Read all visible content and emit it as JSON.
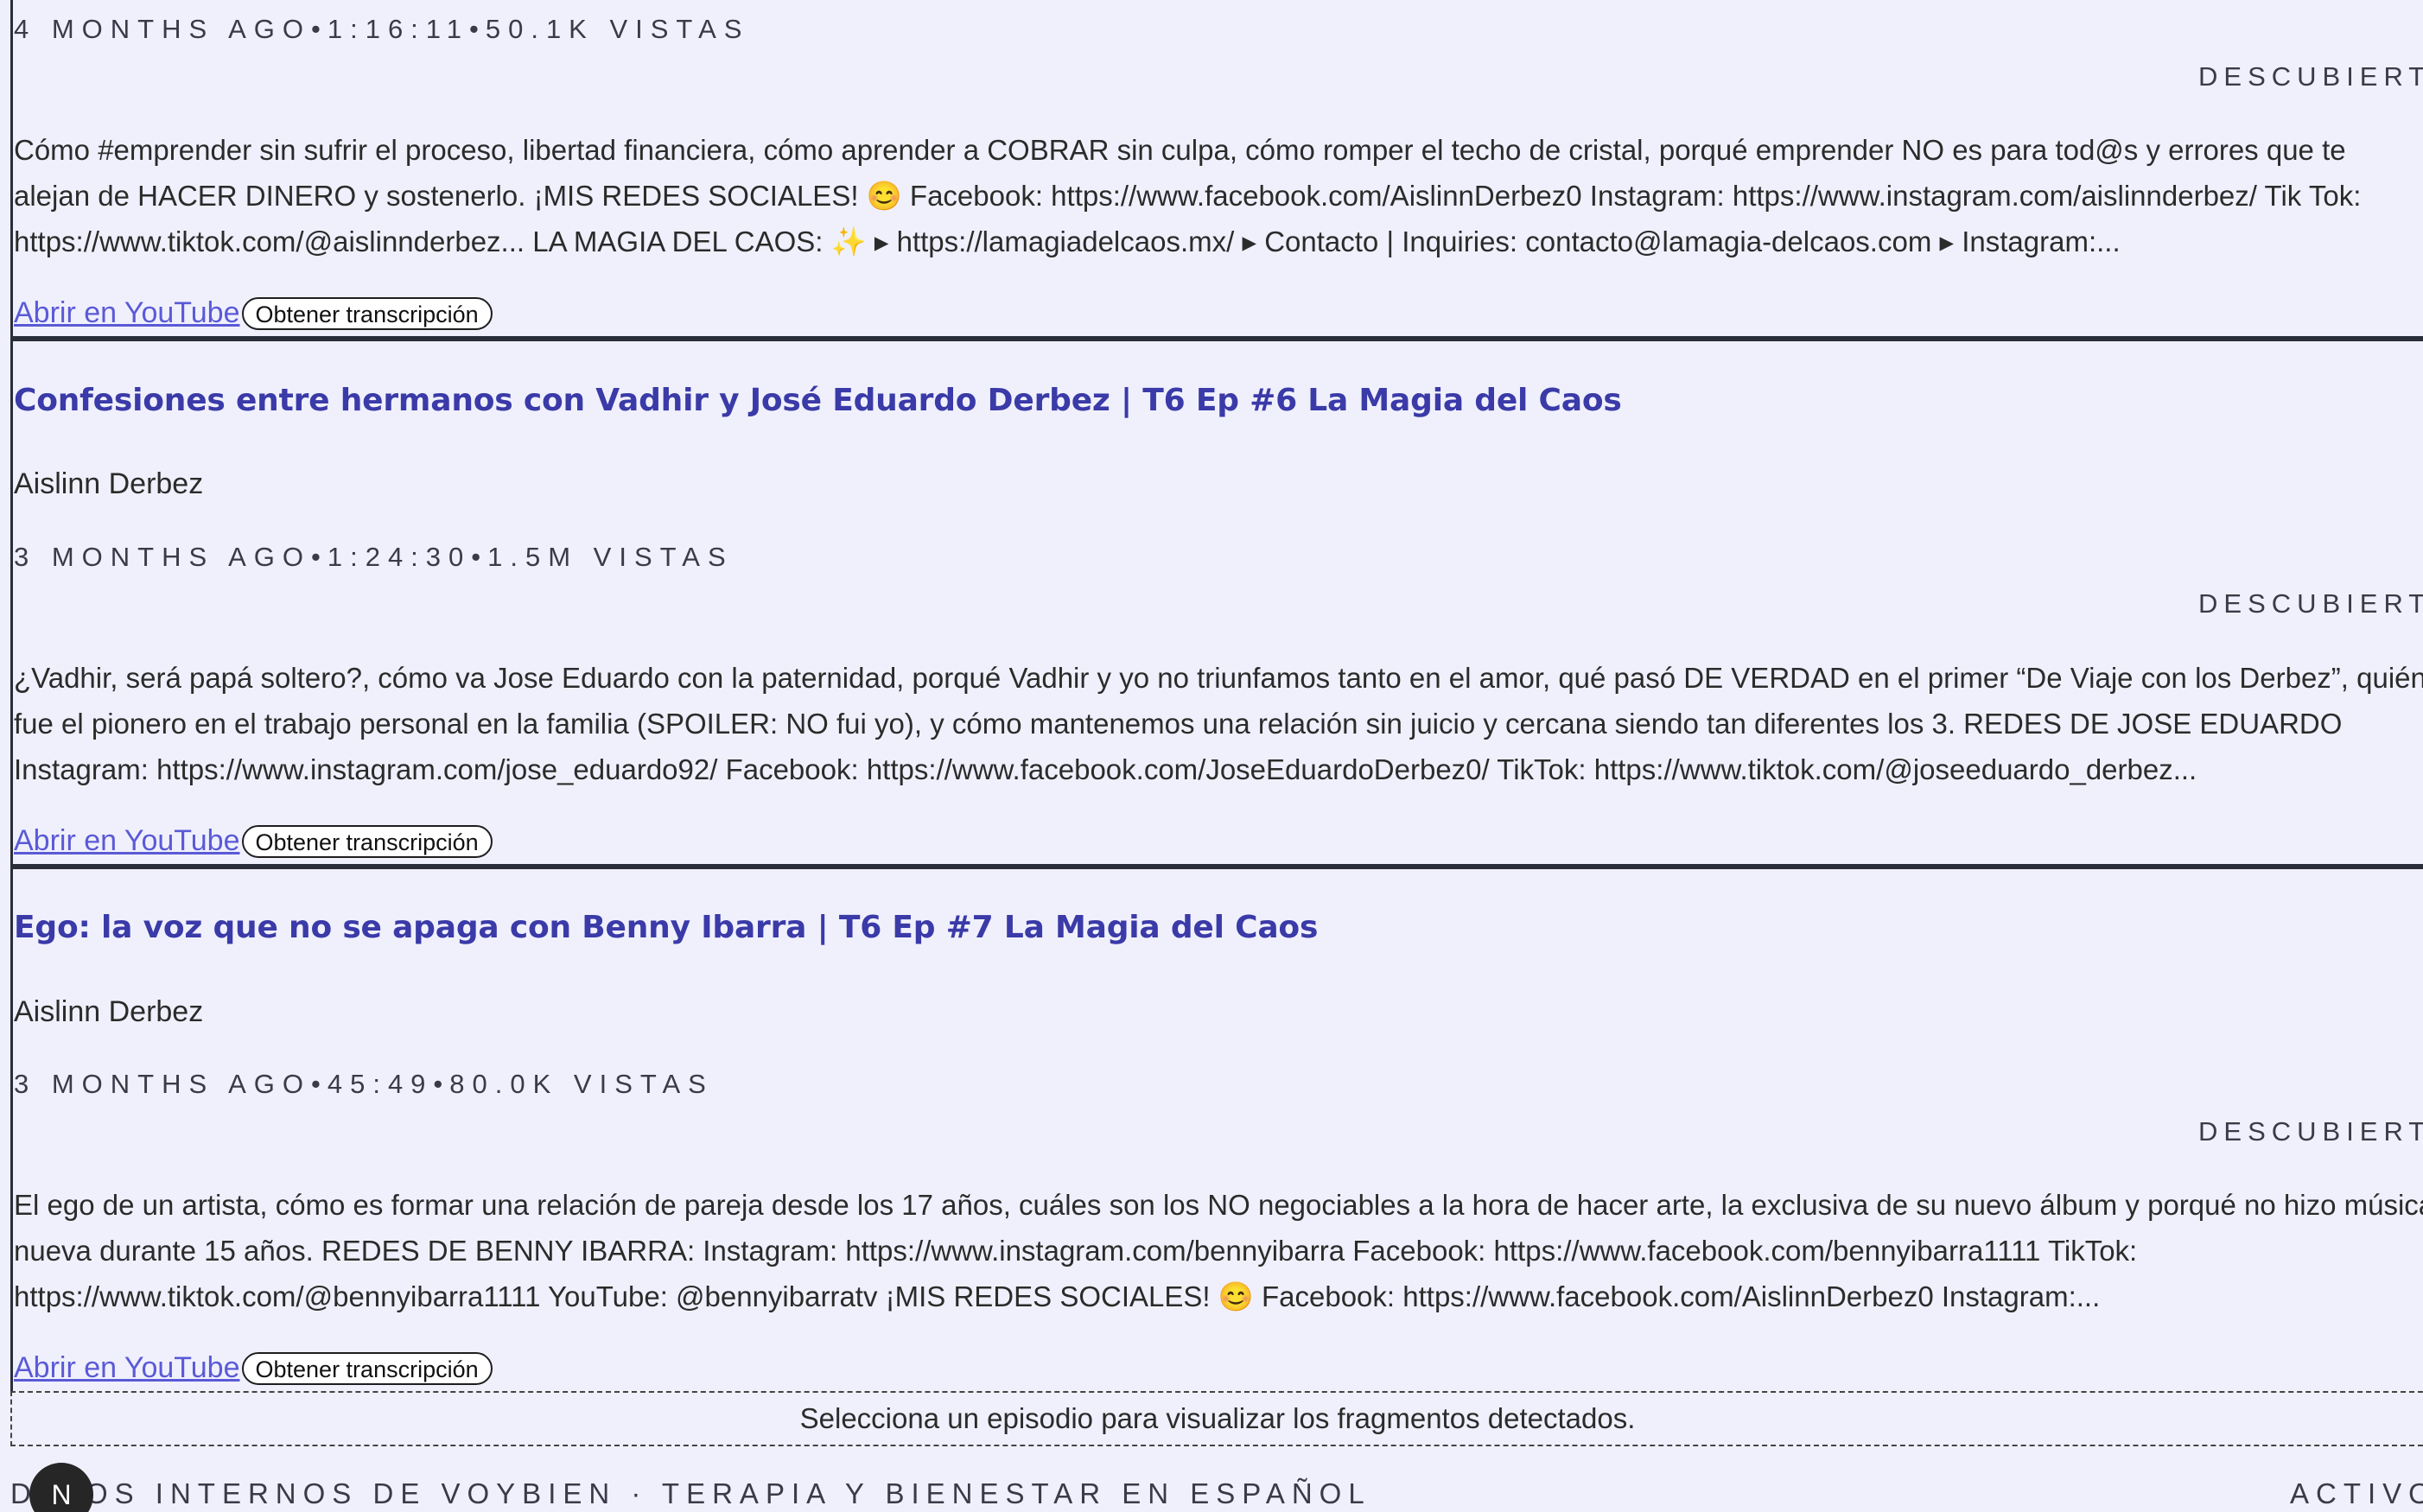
{
  "episodes": [
    {
      "title": "",
      "channel": "",
      "meta": {
        "age": "4 MONTHS AGO",
        "duration": "1:16:11",
        "views": "50.1K VISTAS"
      },
      "status": "DESCUBIERTO",
      "description_lines": [
        "Cómo #emprender sin sufrir el proceso, libertad financiera, cómo aprender a COBRAR sin culpa, cómo romper el techo de cristal, porqué emprender NO es para tod@s y errores que te",
        "alejan de HACER DINERO y sostenerlo. ¡MIS REDES SOCIALES! 😊 Facebook: https://www.facebook.com/AislinnDerbez0 Instagram: https://www.instagram.com/aislinnderbez/ Tik Tok:",
        "https://www.tiktok.com/@aislinnderbez... LA MAGIA DEL CAOS: ✨ ▸ https://lamagiadelcaos.mx/ ▸ Contacto | Inquiries: contacto@lamagia-delcaos.com ▸ Instagram:..."
      ],
      "open_label": "Abrir en YouTube",
      "transcript_label": "Obtener transcripción"
    },
    {
      "title": "Confesiones entre hermanos con Vadhir y José Eduardo Derbez | T6 Ep #6 La Magia del Caos",
      "channel": "Aislinn Derbez",
      "meta": {
        "age": "3 MONTHS AGO",
        "duration": "1:24:30",
        "views": "1.5M VISTAS"
      },
      "status": "DESCUBIERTO",
      "description_lines": [
        "¿Vadhir, será papá soltero?, cómo va Jose Eduardo con la paternidad, porqué Vadhir y yo no triunfamos tanto en el amor, qué pasó DE VERDAD en el primer “De Viaje con los Derbez”, quién",
        "fue el pionero en el trabajo personal en la familia (SPOILER: NO fui yo), y cómo mantenemos una relación sin juicio y cercana siendo tan diferentes los 3. REDES DE JOSE EDUARDO",
        "Instagram: https://www.instagram.com/jose_eduardo92/ Facebook: https://www.facebook.com/JoseEduardoDerbez0/ TikTok: https://www.tiktok.com/@joseeduardo_derbez..."
      ],
      "open_label": "Abrir en YouTube",
      "transcript_label": "Obtener transcripción"
    },
    {
      "title": "Ego: la voz que no se apaga con Benny Ibarra | T6 Ep #7 La Magia del Caos",
      "channel": "Aislinn Derbez",
      "meta": {
        "age": "3 MONTHS AGO",
        "duration": "45:49",
        "views": "80.0K VISTAS"
      },
      "status": "DESCUBIERTO",
      "description_lines": [
        "El ego de un artista, cómo es formar una relación de pareja desde los 17 años, cuáles son los NO negociables a la hora de hacer arte, la exclusiva de su nuevo álbum y porqué no hizo música",
        "nueva durante 15 años. REDES DE BENNY IBARRA: Instagram: https://www.instagram.com/bennyibarra Facebook: https://www.facebook.com/bennyibarra1111 TikTok:",
        "https://www.tiktok.com/@bennyibarra1111 YouTube: @bennyibarratv ¡MIS REDES SOCIALES! 😊 Facebook: https://www.facebook.com/AislinnDerbez0 Instagram:..."
      ],
      "open_label": "Abrir en YouTube",
      "transcript_label": "Obtener transcripción"
    }
  ],
  "fragments_placeholder": "Selecciona un episodio para visualizar los fragmentos detectados.",
  "footer": {
    "text": "DATOS INTERNOS DE VOYBIEN · TERAPIA Y BIENESTAR EN ESPAÑOL",
    "status": "ACTIVO",
    "avatar_letter": "N"
  }
}
